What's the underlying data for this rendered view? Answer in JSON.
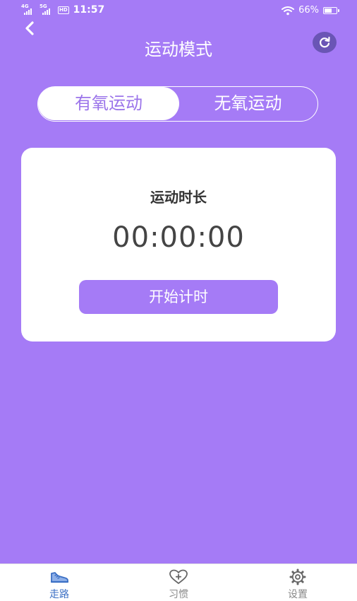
{
  "status_bar": {
    "signal_1": "4G",
    "signal_2": "5G",
    "hd_badge": "HD",
    "time": "11:57",
    "battery_percent": "66%",
    "battery_level": 0.66
  },
  "header": {
    "title": "运动模式",
    "back_icon": "chevron-left-icon",
    "refresh_icon": "refresh-icon"
  },
  "mode_toggle": {
    "options": [
      "有氧运动",
      "无氧运动"
    ],
    "selected_index": 0
  },
  "timer_card": {
    "label": "运动时长",
    "time": "00:00:00",
    "start_button": "开始计时"
  },
  "bottom_nav": {
    "items": [
      {
        "label": "走路",
        "icon": "shoe-icon",
        "active": true
      },
      {
        "label": "习惯",
        "icon": "heart-plus-icon",
        "active": false
      },
      {
        "label": "设置",
        "icon": "gear-icon",
        "active": false
      }
    ]
  },
  "colors": {
    "background": "#a57bf6",
    "active_tab_text": "#9b74ea",
    "refresh_button": "#6a55b5",
    "nav_active": "#3b6fc4",
    "nav_inactive": "#888888"
  }
}
